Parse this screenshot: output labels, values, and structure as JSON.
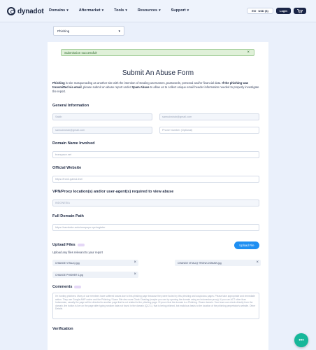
{
  "header": {
    "logo_text": "dynadot",
    "nav": [
      {
        "label": "Domains"
      },
      {
        "label": "Aftermarket"
      },
      {
        "label": "Tools"
      },
      {
        "label": "Resources"
      },
      {
        "label": "Support"
      }
    ],
    "lang_label": "EN · USD ($)",
    "login_label": "Login",
    "cart_icon": "cart-icon"
  },
  "abuse_type_select": {
    "selected": "Phishing"
  },
  "alert": {
    "message": "Submission successful!",
    "close": "×"
  },
  "form": {
    "title": "Submit An Abuse Form",
    "intro_b1": "Phishing",
    "intro_t1": " is site masquerading as another site with the intention of stealing usernames, passwords, personal and/or financial data. ",
    "intro_b2": "If the phishing was transmitted via email",
    "intro_t2": ", please submit an abuse report under ",
    "intro_b3": "Spam Abuse",
    "intro_t3": " to allow us to collect unique email header information needed to properly investigate the report.",
    "general_info_heading": "General Information",
    "name_value": "Sakib",
    "email_value": "samudrahub@gmail.com",
    "confirm_email_value": "samudrahub@gmail.com",
    "phone_placeholder": "Phone Number (Optional)",
    "domain_heading": "Domain Name Involved",
    "domain_value": "tronspace.net",
    "website_heading": "Official Website",
    "website_value": "https://tron2.gabs1.live/",
    "vpn_heading": "VPN/Proxy location(s) and/or user-agent(s) required to view abuse",
    "vpn_value": "INDONESIA",
    "path_heading": "Full Domain Path",
    "path_value": "https://samkeke-aukcionspuyu.xyz/register",
    "upload_heading": "Upload Files",
    "upload_sub": "Upload any files relevant to your report",
    "upload_button": "Upload File",
    "files": [
      {
        "name": "CHANGE VITALIQ.jpg"
      },
      {
        "name": "CHANGE VITALIQ TRON2-DOMAIN.jpg"
      },
      {
        "name": "CHANGE PHISHER 1.jpg"
      }
    ],
    "comments_heading": "Comments",
    "comments_text": "I'm hunting phishers. Many of our members have suffered losses due to this phishing page because they were fooled by this phishing and suspicious pages. Please take appropriate and immediate action. They use Google AMP cache and the Phishing / Scam Site also uses Cloak Cloaking (maybe you can try opening the domain using an Indonesian proxy). If you can ACT other than Indonesian, usually the page will be directed to another page that is not related to the phishing page. I'll prove that the domain is a Phishing / Scam domain. Your team can check directly from the domain, the button is live on the page after typing random data not found in the domain (Q12.1). that is being phished, but malicious leads to the location of the phishing perpetrator's website. Other Details.",
    "verification_heading": "Verification"
  },
  "chat_icon": "chat-bubble-icon"
}
